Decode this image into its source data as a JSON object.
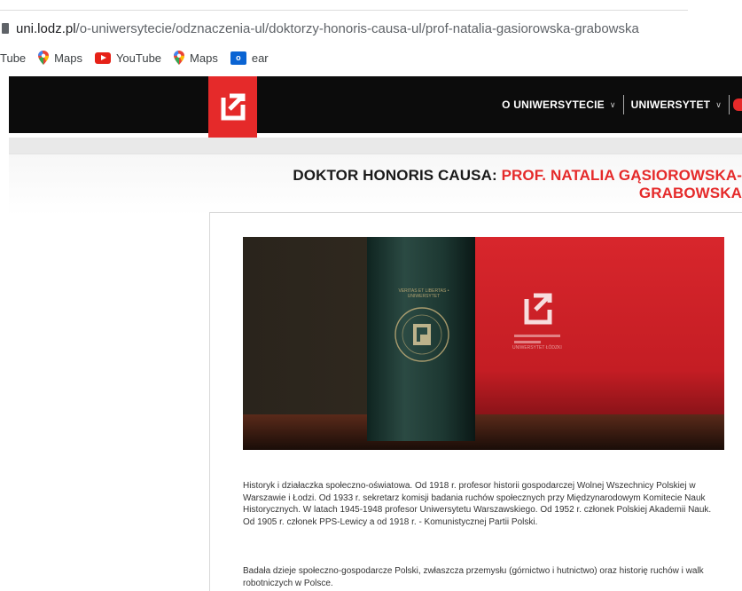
{
  "browser": {
    "url_domain": "uni.lodz.pl",
    "url_path": "/o-uniwersytecie/odznaczenia-ul/doktorzy-honoris-causa-ul/prof-natalia-gasiorowska-grabowska",
    "bookmarks": [
      {
        "label": "Tube",
        "icon": "youtube-icon-partial"
      },
      {
        "label": "Maps",
        "icon": "maps-pin-icon"
      },
      {
        "label": "YouTube",
        "icon": "youtube-icon"
      },
      {
        "label": "Maps",
        "icon": "maps-pin-icon"
      },
      {
        "label": "ear",
        "icon": "outlook-icon"
      }
    ]
  },
  "header": {
    "nav": [
      {
        "label": "O UNIWERSYTECIE"
      },
      {
        "label": "UNIWERSYTET"
      }
    ]
  },
  "page": {
    "title_black": "DOKTOR HONORIS CAUSA: ",
    "title_red_1": "PROF. NATALIA GĄSIOROWSKA-",
    "title_red_2": "GRABOWSKA",
    "photo_seal_text": "VERITAS ET LIBERTAS • UNIWERSYTET",
    "photo_sign_text": "UNIWERSYTET ŁÓDZKI",
    "paragraph_1": "Historyk i działaczka społeczno-oświatowa. Od 1918 r. profesor historii gospodarczej Wolnej Wszechnicy Polskiej w Warszawie i Łodzi. Od 1933 r. sekretarz komisji badania ruchów społecznych przy Międzynarodowym Komitecie Nauk Historycznych. W latach 1945-1948 profesor Uniwersytetu Warszawskiego. Od 1952 r. członek Polskiej Akademii Nauk. Od 1905 r. członek PPS-Lewicy a od 1918 r. - Komunistycznej Partii Polski.",
    "paragraph_2": "Badała dzieje społeczno-gospodarcze Polski, zwłaszcza przemysłu (górnictwo i hutnictwo) oraz historię ruchów i walk robotniczych w Polsce."
  },
  "colors": {
    "brand_red": "#e52a2a",
    "header_black": "#0c0c0c"
  }
}
